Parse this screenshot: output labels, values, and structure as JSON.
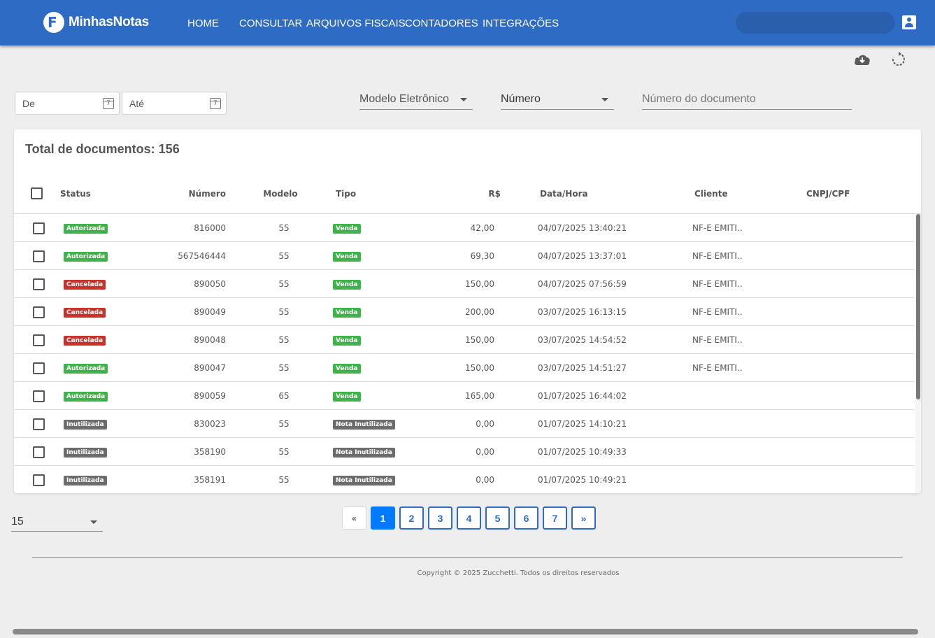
{
  "header": {
    "logo_text": "MinhasNotas",
    "nav": [
      {
        "label": "HOME"
      },
      {
        "label": "CONSULTAR"
      },
      {
        "label": "ARQUIVOS FISCAIS"
      },
      {
        "label": "CONTADORES"
      },
      {
        "label": "INTEGRAÇÕES"
      }
    ],
    "search_placeholder": "",
    "user_icon": "account-box-icon",
    "brand_color": "#2d6bc4"
  },
  "toolbar": {
    "download_icon": "cloud-download-icon",
    "refresh_icon": "refresh-icon"
  },
  "filters": {
    "date_from_placeholder": "De",
    "date_to_placeholder": "Até",
    "calendar_icon_text": "7",
    "model_select_label": "Modelo Eletrônico",
    "number_select_value": "Número",
    "doc_number_placeholder": "Número do documento"
  },
  "table": {
    "total_label": "Total de documentos: 156",
    "columns": [
      "Status",
      "Número",
      "Modelo",
      "Tipo",
      "R$",
      "Data/Hora",
      "Cliente",
      "CNPJ/CPF"
    ],
    "rows": [
      {
        "status": "Autorizada",
        "numero": "816000",
        "modelo": "55",
        "tipo": "Venda",
        "valor": "42,00",
        "data": "04/07/2025 13:40:21",
        "cliente": "NF-E EMITI..",
        "cnpj": ""
      },
      {
        "status": "Autorizada",
        "numero": "567546444",
        "modelo": "55",
        "tipo": "Venda",
        "valor": "69,30",
        "data": "04/07/2025 13:37:01",
        "cliente": "NF-E EMITI..",
        "cnpj": ""
      },
      {
        "status": "Cancelada",
        "numero": "890050",
        "modelo": "55",
        "tipo": "Venda",
        "valor": "150,00",
        "data": "04/07/2025 07:56:59",
        "cliente": "NF-E EMITI..",
        "cnpj": ""
      },
      {
        "status": "Cancelada",
        "numero": "890049",
        "modelo": "55",
        "tipo": "Venda",
        "valor": "200,00",
        "data": "03/07/2025 16:13:15",
        "cliente": "NF-E EMITI..",
        "cnpj": ""
      },
      {
        "status": "Cancelada",
        "numero": "890048",
        "modelo": "55",
        "tipo": "Venda",
        "valor": "150,00",
        "data": "03/07/2025 14:54:52",
        "cliente": "NF-E EMITI..",
        "cnpj": ""
      },
      {
        "status": "Autorizada",
        "numero": "890047",
        "modelo": "55",
        "tipo": "Venda",
        "valor": "150,00",
        "data": "03/07/2025 14:51:27",
        "cliente": "NF-E EMITI..",
        "cnpj": ""
      },
      {
        "status": "Autorizada",
        "numero": "890059",
        "modelo": "65",
        "tipo": "Venda",
        "valor": "165,00",
        "data": "01/07/2025 16:44:02",
        "cliente": "",
        "cnpj": ""
      },
      {
        "status": "Inutilizada",
        "numero": "830023",
        "modelo": "55",
        "tipo": "Nota Inutilizada",
        "valor": "0,00",
        "data": "01/07/2025 14:10:21",
        "cliente": "",
        "cnpj": ""
      },
      {
        "status": "Inutilizada",
        "numero": "358190",
        "modelo": "55",
        "tipo": "Nota Inutilizada",
        "valor": "0,00",
        "data": "01/07/2025 10:49:33",
        "cliente": "",
        "cnpj": ""
      },
      {
        "status": "Inutilizada",
        "numero": "358191",
        "modelo": "55",
        "tipo": "Nota Inutilizada",
        "valor": "0,00",
        "data": "01/07/2025 10:49:21",
        "cliente": "",
        "cnpj": ""
      }
    ],
    "status_colors": {
      "Autorizada": "#3db34a",
      "Cancelada": "#c8322d",
      "Inutilizada": "#6c6c6c"
    },
    "tipo_colors": {
      "Venda": "#3db34a",
      "Nota Inutilizada": "#6c6c6c"
    }
  },
  "pagination": {
    "page_size": "15",
    "first_label": "«",
    "last_label": "»",
    "pages": [
      "1",
      "2",
      "3",
      "4",
      "5",
      "6",
      "7"
    ],
    "current_page": "1"
  },
  "footer": {
    "copyright": "Copyright © 2025 Zucchetti. Todos os direitos reservados"
  }
}
